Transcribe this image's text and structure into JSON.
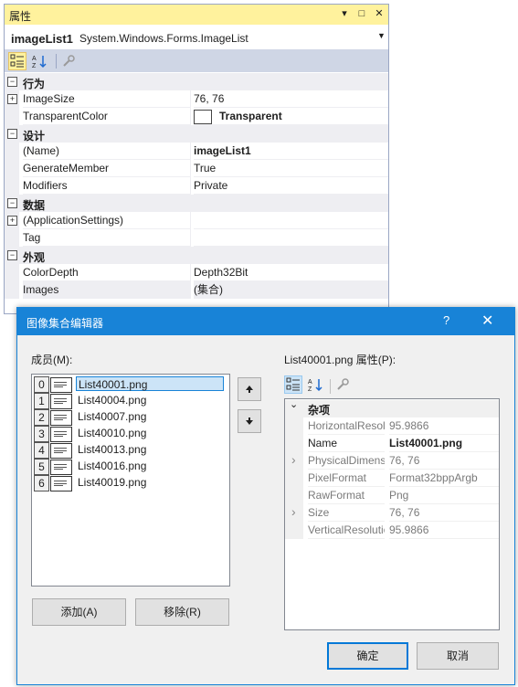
{
  "props_window": {
    "title": "属性",
    "title_buttons": [
      "▾",
      "□",
      "✕"
    ],
    "object_name": "imageList1",
    "object_type": "System.Windows.Forms.ImageList",
    "categories": [
      {
        "label": "行为",
        "rows": [
          {
            "expander": "+",
            "name": "ImageSize",
            "value": "76, 76"
          },
          {
            "name": "TransparentColor",
            "value": "Transparent",
            "swatch": "#ffffff",
            "bold": true
          }
        ]
      },
      {
        "label": "设计",
        "rows": [
          {
            "name": "(Name)",
            "value": "imageList1",
            "bold": true
          },
          {
            "name": "GenerateMember",
            "value": "True"
          },
          {
            "name": "Modifiers",
            "value": "Private"
          }
        ]
      },
      {
        "label": "数据",
        "rows": [
          {
            "expander": "+",
            "name": "(ApplicationSettings)",
            "value": ""
          },
          {
            "name": "Tag",
            "value": ""
          }
        ]
      },
      {
        "label": "外观",
        "rows": [
          {
            "name": "ColorDepth",
            "value": "Depth32Bit"
          },
          {
            "name": "Images",
            "value": "(集合)"
          }
        ]
      }
    ]
  },
  "dialog": {
    "title": "图像集合编辑器",
    "help": "?",
    "close": "✕",
    "members_label": "成员(M):",
    "members": [
      {
        "index": "0",
        "name": "List40001.png"
      },
      {
        "index": "1",
        "name": "List40004.png"
      },
      {
        "index": "2",
        "name": "List40007.png"
      },
      {
        "index": "3",
        "name": "List40010.png"
      },
      {
        "index": "4",
        "name": "List40013.png"
      },
      {
        "index": "5",
        "name": "List40016.png"
      },
      {
        "index": "6",
        "name": "List40019.png"
      }
    ],
    "selected_member": 0,
    "add_button": "添加(A)",
    "remove_button": "移除(R)",
    "props_label": "List40001.png 属性(P):",
    "category": "杂项",
    "properties": [
      {
        "name": "HorizontalResolution",
        "value": "95.9866"
      },
      {
        "name": "Name",
        "value": "List40001.png",
        "emphasis": true
      },
      {
        "name": "PhysicalDimension",
        "value": "76, 76",
        "expandable": true
      },
      {
        "name": "PixelFormat",
        "value": "Format32bppArgb"
      },
      {
        "name": "RawFormat",
        "value": "Png"
      },
      {
        "name": "Size",
        "value": "76, 76",
        "expandable": true
      },
      {
        "name": "VerticalResolution",
        "value": "95.9866"
      }
    ],
    "ok_button": "确定",
    "cancel_button": "取消"
  },
  "colors": {
    "title_highlight": "#fff29d",
    "dialog_title": "#1883d7",
    "category_bg": "#eeeef2"
  }
}
